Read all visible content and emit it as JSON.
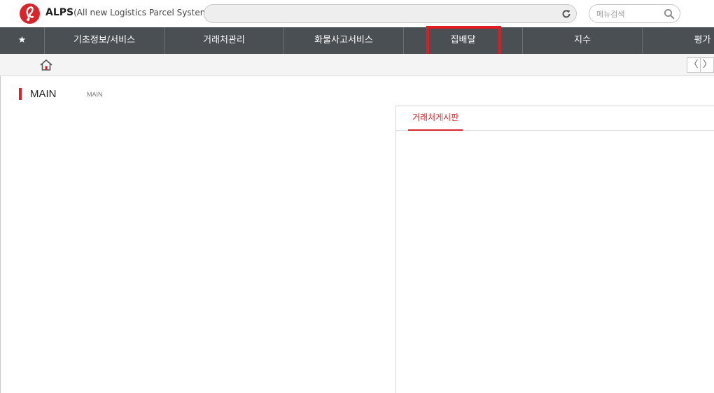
{
  "app": {
    "brand_short": "ALPS",
    "brand_full": "(All new Logistics Parcel System)",
    "logo_letter": "l",
    "accent": "#d8242b"
  },
  "urlbar": {
    "value": "",
    "refresh_icon": "refresh-icon"
  },
  "search": {
    "placeholder": "메뉴검색",
    "icon": "search-icon"
  },
  "nav": {
    "favorites": "★",
    "items": [
      "기초정보/서비스",
      "거래처관리",
      "화물사고서비스",
      "집배달",
      "지수",
      "평가"
    ],
    "highlighted": "집배달",
    "background": "#4a4f54",
    "highlight_color": "#e21b23"
  },
  "subbar": {
    "home_icon": "home-icon",
    "prev": "〈",
    "next": "〉"
  },
  "page": {
    "title": "MAIN",
    "breadcrumb": "MAIN"
  },
  "panel": {
    "tab": "거래처게시판"
  }
}
